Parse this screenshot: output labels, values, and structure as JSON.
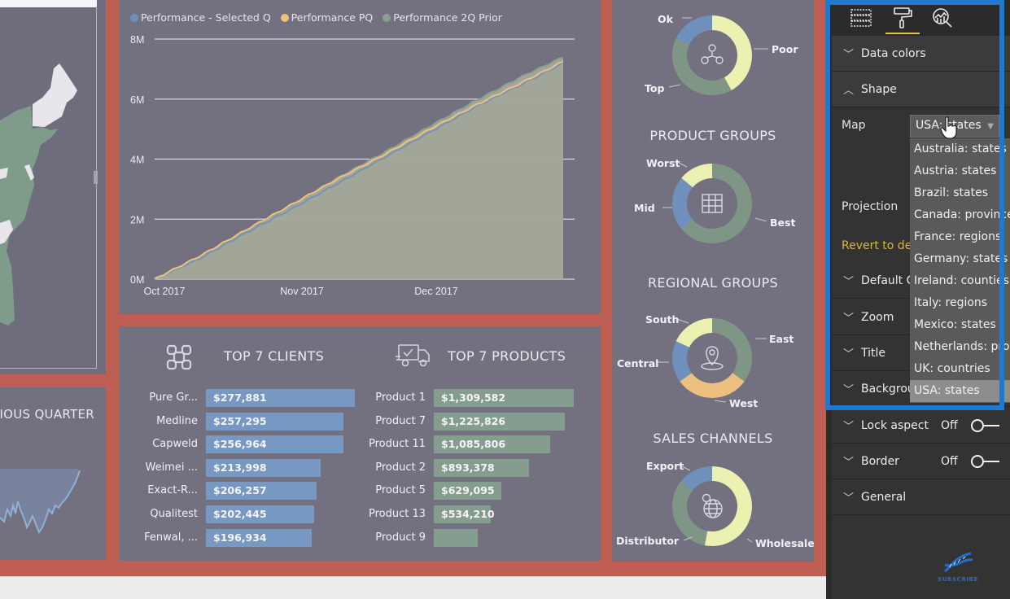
{
  "colors": {
    "selected_q": "#6f8fbd",
    "pq": "#f0c07c",
    "prior_2q": "#8a9f92",
    "bar_clients": "#7698c2",
    "bar_products": "#849d8f",
    "donut_blue": "#6f8fbd",
    "donut_yellow": "#ecf0b0",
    "donut_green": "#7f9686",
    "donut_orange": "#ecc07e",
    "pane_highlight": "#1f79d1",
    "revert_link": "#d9b83a"
  },
  "map_panel": {
    "name": "USA states map (partial)"
  },
  "quarter_panel": {
    "title": "VIOUS QUARTER"
  },
  "chart_data": [
    {
      "type": "area",
      "title": "",
      "legend": [
        "Performance - Selected Q",
        "Performance PQ",
        "Performance 2Q Prior"
      ],
      "legend_position": "top-left",
      "xlabel": "",
      "ylabel": "",
      "x_ticks": [
        "Oct 2017",
        "Nov 2017",
        "Dec 2017"
      ],
      "y_ticks": [
        "0M",
        "2M",
        "4M",
        "6M",
        "8M"
      ],
      "ylim": [
        0,
        8000000
      ],
      "grid": true,
      "x": [
        0,
        10,
        20,
        30,
        40,
        50,
        60,
        70,
        80,
        89
      ],
      "series": [
        {
          "name": "Performance - Selected Q",
          "values": [
            0,
            700000,
            1550000,
            2350000,
            3200000,
            4050000,
            4900000,
            5750000,
            6500000,
            7200000
          ]
        },
        {
          "name": "Performance PQ",
          "values": [
            0,
            780000,
            1650000,
            2500000,
            3350000,
            4150000,
            5000000,
            5800000,
            6550000,
            7250000
          ]
        },
        {
          "name": "Performance 2Q Prior",
          "values": [
            0,
            760000,
            1620000,
            2480000,
            3380000,
            4220000,
            5100000,
            5950000,
            6750000,
            7400000
          ]
        }
      ]
    },
    {
      "type": "bar",
      "title": "TOP 7 CLIENTS",
      "orientation": "horizontal",
      "categories": [
        "Pure Gr...",
        "Medline",
        "Capweld",
        "Weimei ...",
        "Exact-R...",
        "Qualitest",
        "Fenwal, ..."
      ],
      "values": [
        277881,
        257295,
        256964,
        213998,
        206257,
        202445,
        196934
      ],
      "value_labels": [
        "$277,881",
        "$257,295",
        "$256,964",
        "$213,998",
        "$206,257",
        "$202,445",
        "$196,934"
      ]
    },
    {
      "type": "bar",
      "title": "TOP 7 PRODUCTS",
      "orientation": "horizontal",
      "categories": [
        "Product 1",
        "Product 7",
        "Product 11",
        "Product 2",
        "Product 5",
        "Product 13",
        "Product 9"
      ],
      "values": [
        1309582,
        1225826,
        1085806,
        893378,
        629095,
        534210,
        410000
      ],
      "value_labels": [
        "$1,309,582",
        "$1,225,826",
        "$1,085,806",
        "$893,378",
        "$629,095",
        "$534,210",
        ""
      ]
    },
    {
      "type": "pie",
      "title": "",
      "donut": true,
      "center_icon": "people-hierarchy-icon",
      "categories": [
        "Poor",
        "Top",
        "Ok"
      ],
      "values": [
        42,
        40,
        18
      ],
      "colors_keys": [
        "donut_yellow",
        "donut_green",
        "donut_blue"
      ]
    },
    {
      "type": "pie",
      "title": "PRODUCT GROUPS",
      "donut": true,
      "center_icon": "shelves-icon",
      "categories": [
        "Best",
        "Mid",
        "Worst"
      ],
      "values": [
        64,
        22,
        14
      ],
      "colors_keys": [
        "donut_green",
        "donut_blue",
        "donut_yellow"
      ]
    },
    {
      "type": "pie",
      "title": "REGIONAL GROUPS",
      "donut": true,
      "center_icon": "location-pin-icon",
      "categories": [
        "East",
        "West",
        "Central",
        "South"
      ],
      "values": [
        35,
        30,
        17,
        18
      ],
      "colors_keys": [
        "donut_green",
        "donut_orange",
        "donut_blue",
        "donut_yellow"
      ]
    },
    {
      "type": "pie",
      "title": "SALES CHANNELS",
      "donut": true,
      "center_icon": "globe-dollar-icon",
      "categories": [
        "Wholesale",
        "Distributor",
        "Export"
      ],
      "values": [
        53,
        33,
        14
      ],
      "colors_keys": [
        "donut_yellow",
        "donut_green",
        "donut_blue"
      ]
    }
  ],
  "format_pane": {
    "tabs": [
      {
        "icon": "fields-icon",
        "active": false
      },
      {
        "icon": "paint-roller-icon",
        "active": true
      },
      {
        "icon": "analytics-icon",
        "active": false
      }
    ],
    "sections": {
      "data_colors": "Data colors",
      "shape": "Shape",
      "default_color": "Default C",
      "zoom": "Zoom",
      "title": "Title",
      "background": "Backgrou",
      "lock_aspect": "Lock aspect",
      "border": "Border",
      "general": "General"
    },
    "lock_aspect_state": "Off",
    "border_state": "Off",
    "map_label": "Map",
    "map_value": "USA: states",
    "projection_label": "Projection",
    "revert_label": "Revert to def",
    "map_options": [
      "Australia: states",
      "Austria: states",
      "Brazil: states",
      "Canada: provinces",
      "France: regions",
      "Germany: states",
      "Ireland: counties",
      "Italy: regions",
      "Mexico: states",
      "Netherlands: provinces",
      "UK: countries",
      "USA: states"
    ],
    "selected_option": "USA: states",
    "subscribe_label": "SUBSCRIBE"
  }
}
